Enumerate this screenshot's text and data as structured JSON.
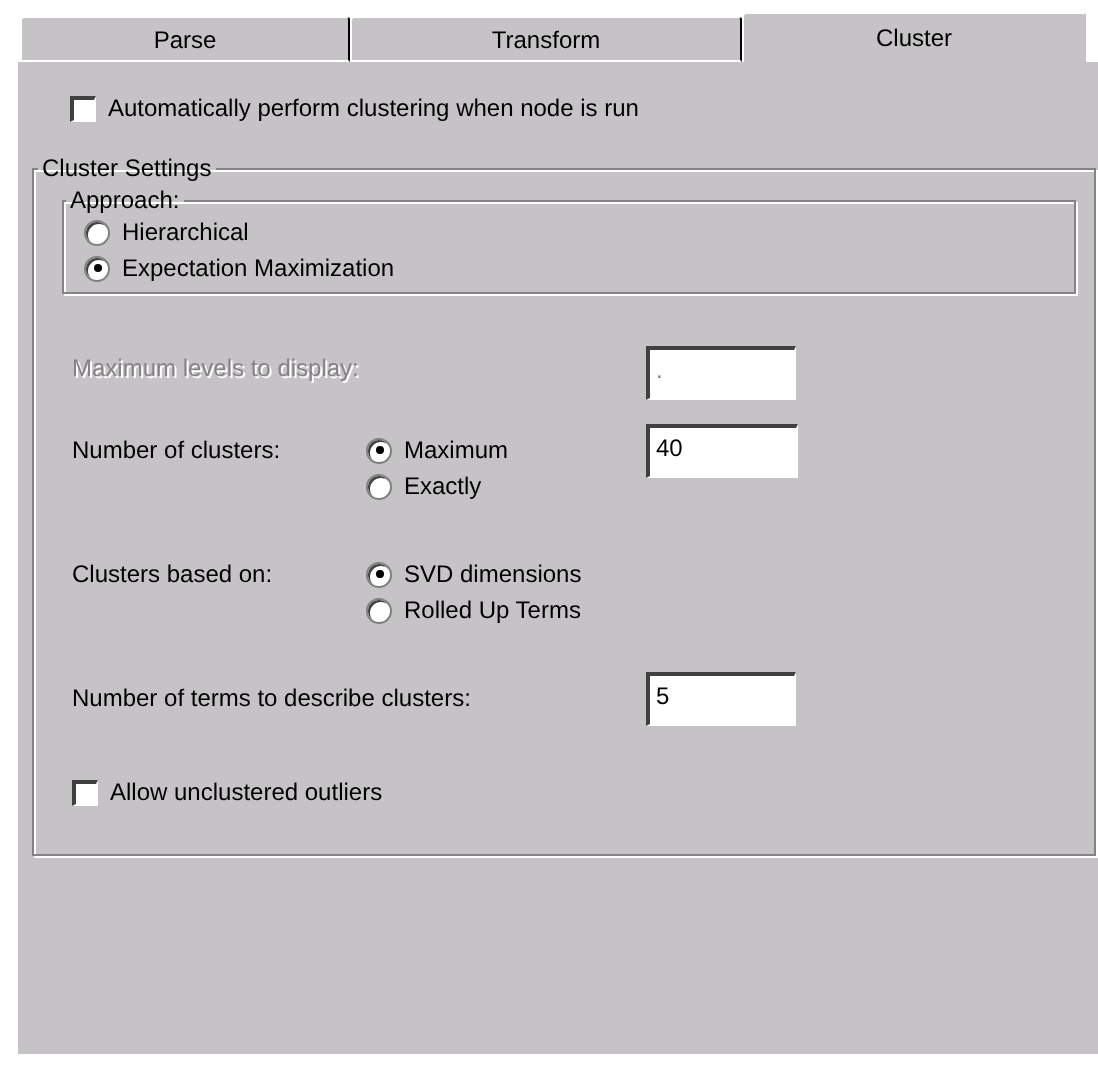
{
  "tabs": [
    {
      "label": "Parse",
      "selected": false
    },
    {
      "label": "Transform",
      "selected": false
    },
    {
      "label": "Cluster",
      "selected": true
    }
  ],
  "auto_cluster": {
    "label": "Automatically perform clustering when node is run",
    "checked": false
  },
  "cluster_settings": {
    "title": "Cluster Settings",
    "approach": {
      "title": "Approach:",
      "options": [
        {
          "label": "Hierarchical",
          "selected": false
        },
        {
          "label": "Expectation Maximization",
          "selected": true
        }
      ]
    },
    "max_levels": {
      "label": "Maximum levels to display:",
      "value": ".",
      "disabled": true
    },
    "num_clusters": {
      "label": "Number of clusters:",
      "options": [
        {
          "label": "Maximum",
          "selected": true
        },
        {
          "label": "Exactly",
          "selected": false
        }
      ],
      "value": "40"
    },
    "based_on": {
      "label": "Clusters based on:",
      "options": [
        {
          "label": "SVD dimensions",
          "selected": true
        },
        {
          "label": "Rolled Up Terms",
          "selected": false
        }
      ]
    },
    "num_terms": {
      "label": "Number of terms to describe clusters:",
      "value": "5"
    },
    "outliers": {
      "label": "Allow unclustered outliers",
      "checked": false
    }
  }
}
